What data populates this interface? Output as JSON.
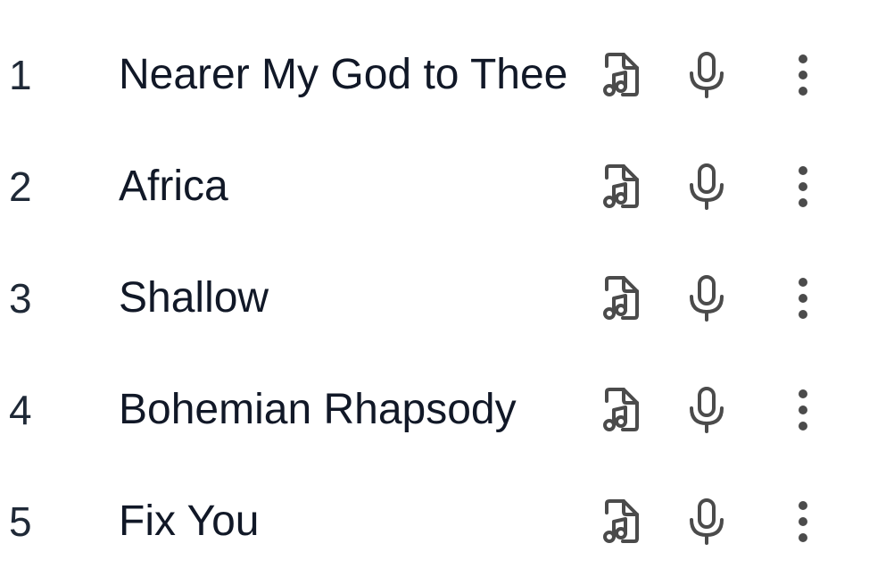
{
  "tracks": [
    {
      "number": "1",
      "title": "Nearer My God to Thee"
    },
    {
      "number": "2",
      "title": "Africa"
    },
    {
      "number": "3",
      "title": "Shallow"
    },
    {
      "number": "4",
      "title": "Bohemian Rhapsody"
    },
    {
      "number": "5",
      "title": "Fix You"
    }
  ],
  "icons": {
    "sheet": "music-file-icon",
    "mic": "microphone-icon",
    "more": "more-vertical-icon"
  },
  "colors": {
    "text": "#111827",
    "icon": "#4b4b4b",
    "background": "#ffffff"
  }
}
